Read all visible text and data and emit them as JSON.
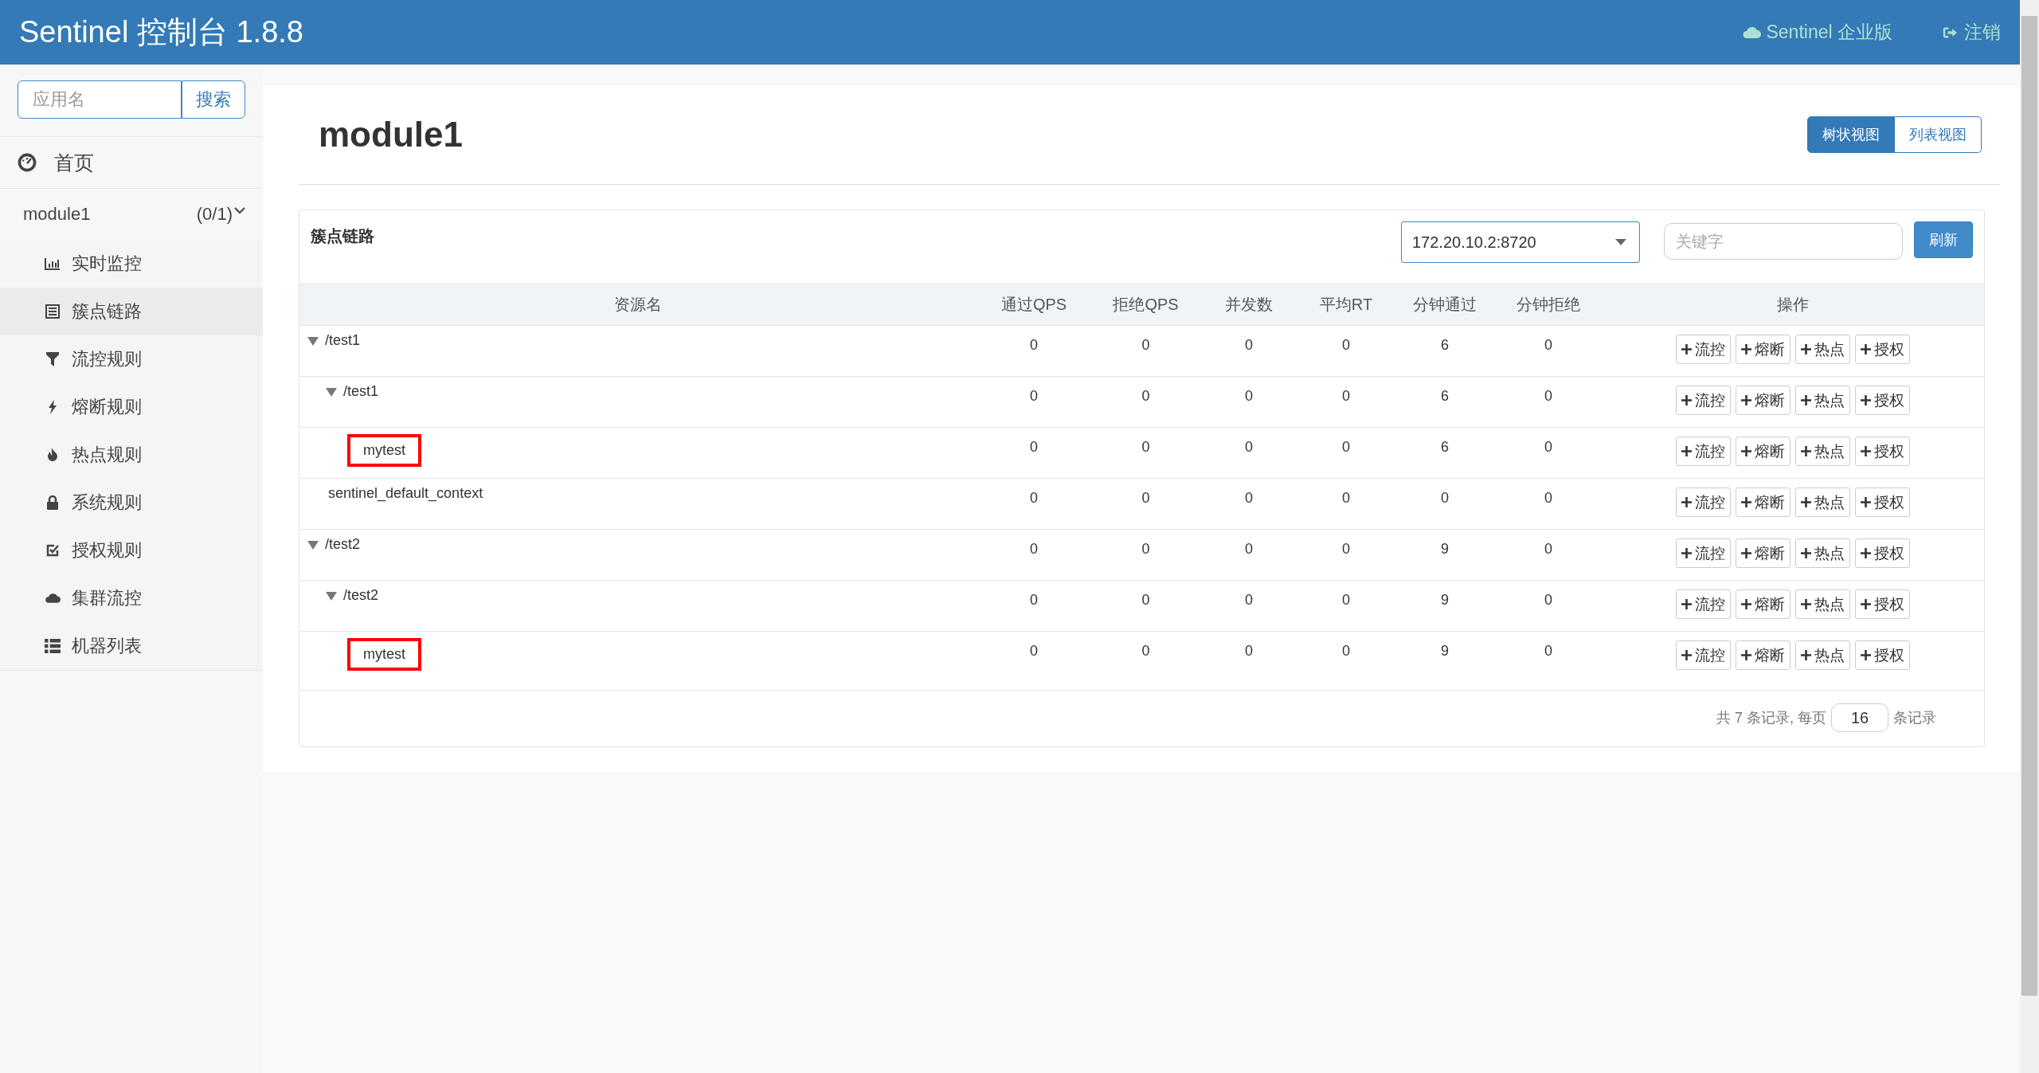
{
  "header": {
    "title": "Sentinel 控制台 1.8.8",
    "links": [
      {
        "label": "Sentinel 企业版"
      },
      {
        "label": "注销"
      }
    ]
  },
  "sidebar": {
    "search": {
      "placeholder": "应用名",
      "button": "搜索"
    },
    "home": "首页",
    "app": {
      "name": "module1",
      "count": "(0/1)",
      "expanded": true
    },
    "items": [
      {
        "label": "实时监控",
        "selected": false
      },
      {
        "label": "簇点链路",
        "selected": true
      },
      {
        "label": "流控规则",
        "selected": false
      },
      {
        "label": "熔断规则",
        "selected": false
      },
      {
        "label": "热点规则",
        "selected": false
      },
      {
        "label": "系统规则",
        "selected": false
      },
      {
        "label": "授权规则",
        "selected": false
      },
      {
        "label": "集群流控",
        "selected": false
      },
      {
        "label": "机器列表",
        "selected": false
      }
    ]
  },
  "main": {
    "title": "module1",
    "views": [
      {
        "label": "树状视图",
        "selected": true
      },
      {
        "label": "列表视图",
        "selected": false
      }
    ],
    "panel": {
      "title": "簇点链路",
      "machine": "172.20.10.2:8720",
      "keyword_placeholder": "关键字",
      "refresh": "刷新",
      "columns": [
        "资源名",
        "通过QPS",
        "拒绝QPS",
        "并发数",
        "平均RT",
        "分钟通过",
        "分钟拒绝",
        "操作"
      ],
      "rows": [
        {
          "name": "/test1",
          "expanded": true,
          "marked": false,
          "values": [
            "0",
            "0",
            "0",
            "0",
            "6",
            "0"
          ],
          "actions": [
            "流控",
            "熔断",
            "热点",
            "授权"
          ],
          "children": [
            {
              "name": "/test1",
              "expanded": true,
              "marked": false,
              "values": [
                "0",
                "0",
                "0",
                "0",
                "6",
                "0"
              ],
              "actions": [
                "流控",
                "熔断",
                "热点",
                "授权"
              ],
              "children": [
                {
                  "name": "mytest",
                  "marked": true,
                  "values": [
                    "0",
                    "0",
                    "0",
                    "0",
                    "6",
                    "0"
                  ],
                  "actions": [
                    "流控",
                    "熔断",
                    "热点",
                    "授权"
                  ]
                }
              ]
            }
          ]
        },
        {
          "name": "sentinel_default_context",
          "marked": false,
          "values": [
            "0",
            "0",
            "0",
            "0",
            "0",
            "0"
          ],
          "actions": [
            "流控",
            "熔断",
            "热点",
            "授权"
          ]
        },
        {
          "name": "/test2",
          "expanded": true,
          "marked": false,
          "values": [
            "0",
            "0",
            "0",
            "0",
            "9",
            "0"
          ],
          "actions": [
            "流控",
            "熔断",
            "热点",
            "授权"
          ],
          "children": [
            {
              "name": "/test2",
              "expanded": true,
              "marked": false,
              "values": [
                "0",
                "0",
                "0",
                "0",
                "9",
                "0"
              ],
              "actions": [
                "流控",
                "熔断",
                "热点",
                "授权"
              ],
              "children": [
                {
                  "name": "mytest",
                  "marked": true,
                  "values": [
                    "0",
                    "0",
                    "0",
                    "0",
                    "9",
                    "0"
                  ],
                  "actions": [
                    "流控",
                    "熔断",
                    "热点",
                    "授权"
                  ]
                }
              ]
            }
          ]
        }
      ],
      "pagination": {
        "summary": "共 7 条记录, 每页",
        "page_size": "16",
        "suffix": "条记录"
      }
    }
  }
}
